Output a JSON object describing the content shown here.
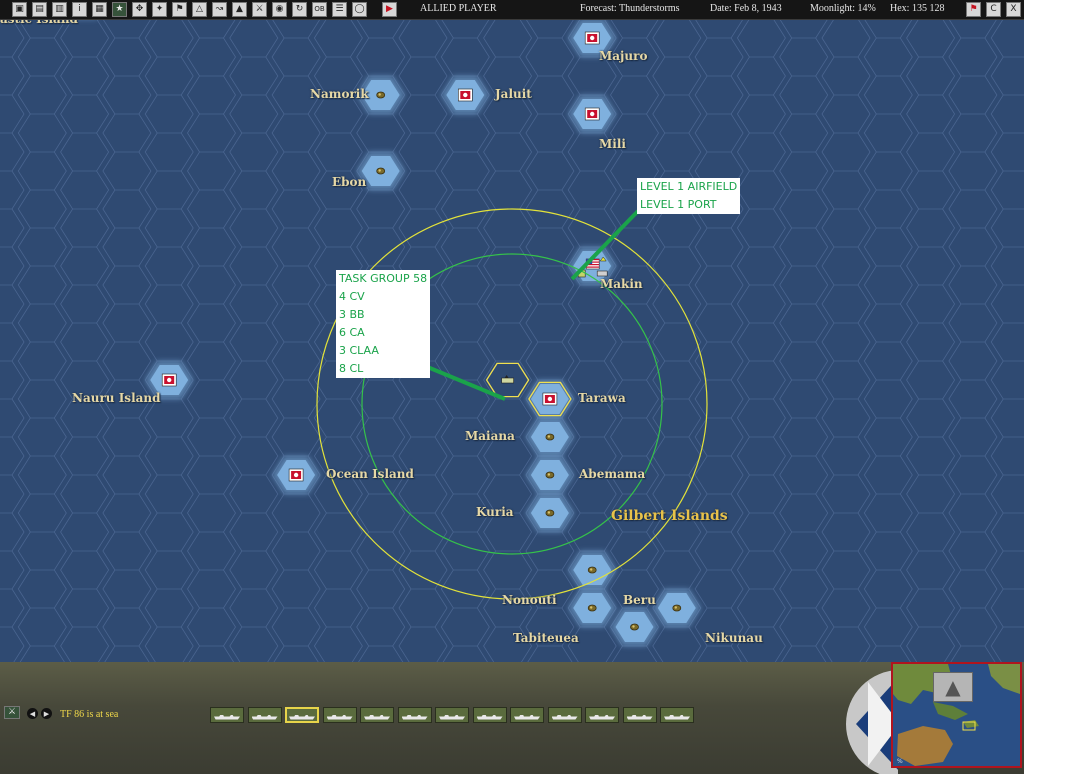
{
  "toolbar": {
    "icons": [
      "map-icon",
      "report-icon",
      "clipboard-icon",
      "info-icon",
      "unit-icon",
      "star-icon",
      "aircraft-icon",
      "plane-icon",
      "flag-icon",
      "ship-icon",
      "route-icon",
      "terrain-icon",
      "task-force-icon",
      "globe-icon",
      "sync-icon",
      "ob-icon",
      "list-icon",
      "orbit-icon",
      "end-turn-icon"
    ],
    "ob_label": "OB",
    "info_label": "i",
    "side": "ALLIED PLAYER",
    "forecast": "Forecast: Thunderstorms",
    "date": "Date: Feb 8, 1943",
    "moonlight": "Moonlight: 14%",
    "hex": "Hex: 135 128",
    "right_buttons": [
      "flag-icon",
      "c-button",
      "close-button"
    ],
    "c_label": "C",
    "close_label": "X"
  },
  "map": {
    "colors": {
      "ocean": "#2f4a72",
      "hex_grid": "#4a6590",
      "shallow": "#7fb0df",
      "yellow_ring": "#e2e23a",
      "green_ring": "#35c24a",
      "japan": "#c8102e",
      "allied": "#2b4aa8"
    },
    "partial_label": "astic Island",
    "locations": [
      {
        "name": "Majuro",
        "owner": "japan"
      },
      {
        "name": "Namorik",
        "owner": "none"
      },
      {
        "name": "Jaluit",
        "owner": "japan"
      },
      {
        "name": "Mili",
        "owner": "japan"
      },
      {
        "name": "Ebon",
        "owner": "none"
      },
      {
        "name": "Makin",
        "owner": "allied"
      },
      {
        "name": "Nauru Island",
        "owner": "japan"
      },
      {
        "name": "Tarawa",
        "owner": "japan"
      },
      {
        "name": "Maiana",
        "owner": "none"
      },
      {
        "name": "Ocean Island",
        "owner": "japan"
      },
      {
        "name": "Abemama",
        "owner": "none"
      },
      {
        "name": "Kuria",
        "owner": "none"
      },
      {
        "name": "Nonouti",
        "owner": "none"
      },
      {
        "name": "Beru",
        "owner": "none"
      },
      {
        "name": "Tabiteuea",
        "owner": "none"
      },
      {
        "name": "Nikunau",
        "owner": "none"
      }
    ],
    "region_label": "Gilbert Islands",
    "airfield_note": [
      "LEVEL 1 AIRFIELD",
      "LEVEL 1 PORT"
    ],
    "task_group_note": [
      "TASK GROUP 58",
      "4 CV",
      "3 BB",
      "6 CA",
      "3 CLAA",
      "8 CL"
    ]
  },
  "bottom": {
    "tf_status": "TF 86 is at sea",
    "ship_slots": 13,
    "selected_slot": 3
  }
}
